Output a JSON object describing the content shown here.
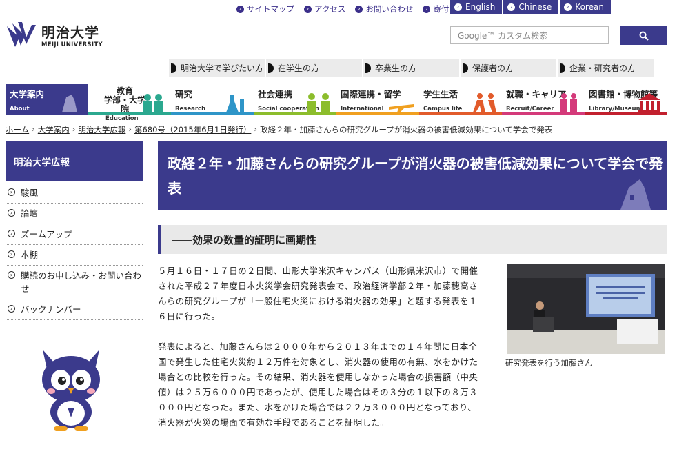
{
  "utility": [
    {
      "label": "サイトマップ"
    },
    {
      "label": "アクセス"
    },
    {
      "label": "お問い合わせ"
    },
    {
      "label": "寄付"
    }
  ],
  "languages": [
    "English",
    "Chinese",
    "Korean"
  ],
  "logo": {
    "ja": "明治大学",
    "en": "MEIJI UNIVERSITY"
  },
  "search": {
    "placeholder": "Google™ カスタム検索",
    "button_icon": "search-icon"
  },
  "audience": [
    "明治大学で学びたい方",
    "在学生の方",
    "卒業生の方",
    "保護者の方",
    "企業・研究者の方"
  ],
  "nav": [
    {
      "ja": "大学案内",
      "en": "About",
      "color": "#3b3a8c",
      "active": true
    },
    {
      "ja": "教育\n学部・大学院",
      "en": "Education",
      "color": "#2ba88f"
    },
    {
      "ja": "研究",
      "en": "Research",
      "color": "#2e95c8"
    },
    {
      "ja": "社会連携",
      "en": "Social cooperation",
      "color": "#8cbd2c"
    },
    {
      "ja": "国際連携・留学",
      "en": "International",
      "color": "#f0a020"
    },
    {
      "ja": "学生生活",
      "en": "Campus life",
      "color": "#e25b2b"
    },
    {
      "ja": "就職・キャリア",
      "en": "Recruit/Career",
      "color": "#d43a7a"
    },
    {
      "ja": "図書館・博物館等",
      "en": "Library/Museum",
      "color": "#c2202e"
    }
  ],
  "breadcrumb": {
    "items": [
      "ホーム",
      "大学案内",
      "明治大学広報",
      "第680号（2015年6月1日発行）"
    ],
    "current": "政経２年・加藤さんらの研究グループが消火器の被害低減効果について学会で発表"
  },
  "sidebar": {
    "title": "明治大学広報",
    "items": [
      "駿風",
      "論壇",
      "ズームアップ",
      "本棚",
      "購読のお申し込み・お問い合わせ",
      "バックナンバー"
    ]
  },
  "article": {
    "title": "政経２年・加藤さんらの研究グループが消火器の被害低減効果について学会で発表",
    "subheading": "――効果の数量的証明に画期性",
    "paragraphs": [
      "５月１６日・１７日の２日間、山形大学米沢キャンパス（山形県米沢市）で開催された平成２７年度日本火災学会研究発表会で、政治経済学部２年・加藤穂高さんらの研究グループが「一般住宅火災における消火器の効果」と題する発表を１６日に行った。",
      "発表によると、加藤さんらは２０００年から２０１３年までの１４年間に日本全国で発生した住宅火災約１２万件を対象とし、消火器の使用の有無、水をかけた場合との比較を行った。その結果、消火器を使用しなかった場合の損害額（中央値）は２５万６０００円であったが、使用した場合はその３分の１以下の８万３０００円となった。また、水をかけた場合では２２万３０００円となっており、消火器が火災の場面で有効な手段であることを証明した。"
    ],
    "photo_caption": "研究発表を行う加藤さん"
  }
}
